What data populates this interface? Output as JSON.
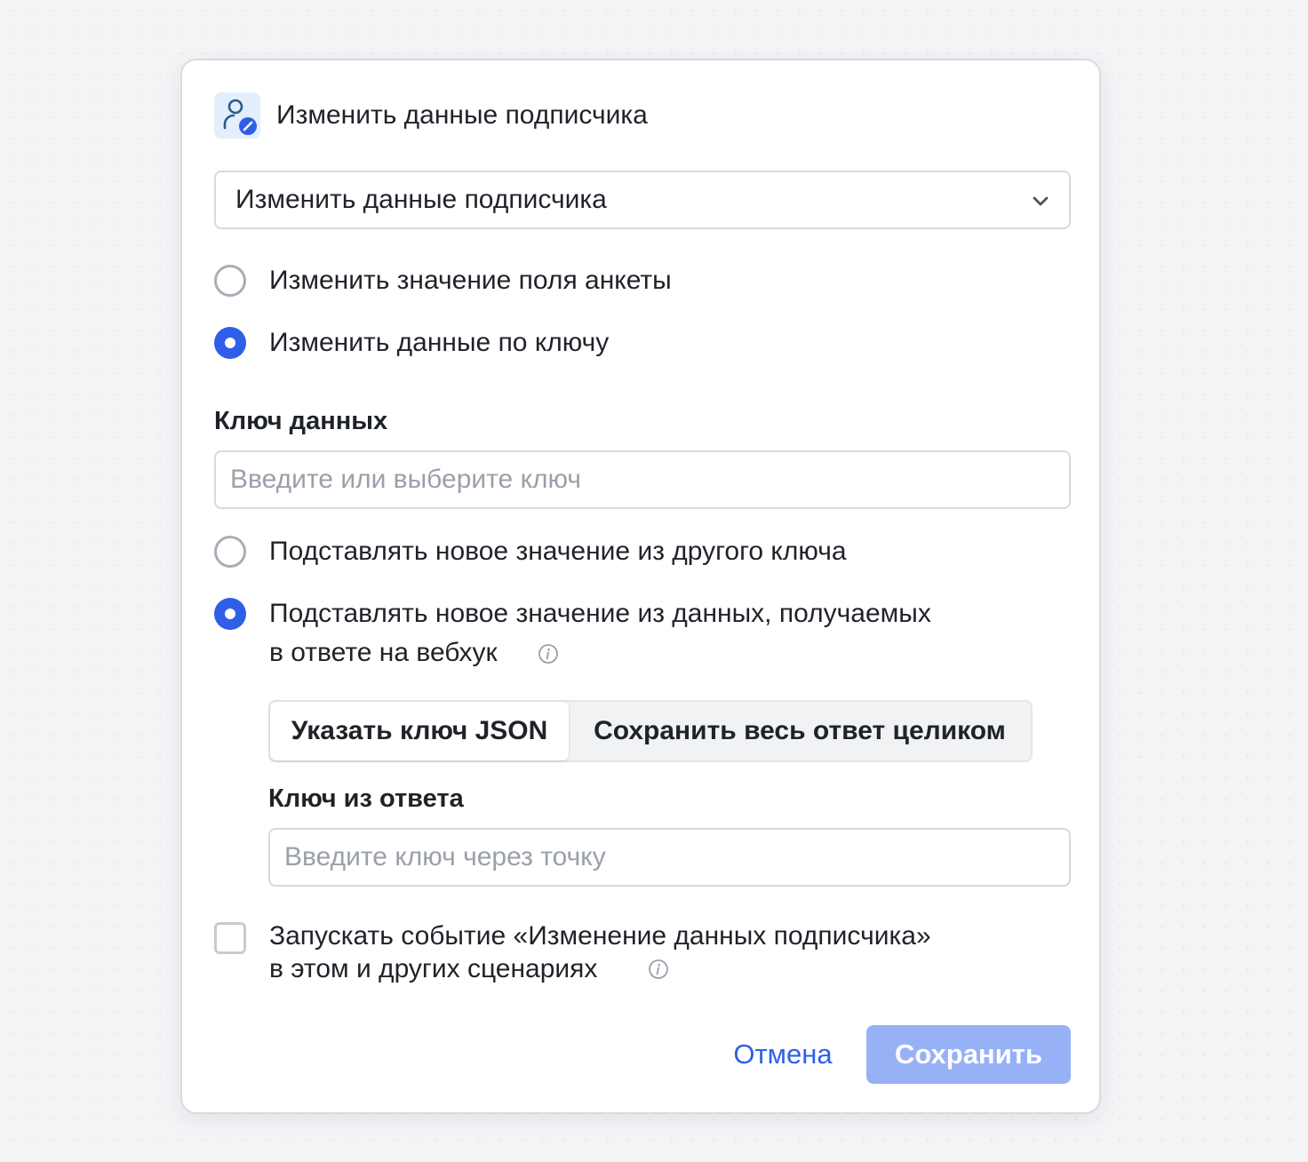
{
  "header": {
    "icon": "user-edit-icon",
    "title": "Изменить данные подписчика"
  },
  "action_select": {
    "value": "Изменить данные подписчика",
    "icon": "chevron-down-icon"
  },
  "mode_options": [
    {
      "label": "Изменить значение поля анкеты",
      "selected": false
    },
    {
      "label": "Изменить данные по ключу",
      "selected": true
    }
  ],
  "data_key": {
    "label": "Ключ данных",
    "placeholder": "Введите или выберите ключ",
    "value": ""
  },
  "source_options": [
    {
      "label": "Подставлять новое значение из другого ключа",
      "selected": false
    },
    {
      "label_line1": "Подставлять новое значение из данных, получаемых",
      "label_line2": "в ответе на вебхук",
      "selected": true,
      "info_icon": "info-icon"
    }
  ],
  "segmented": {
    "options": [
      "Указать ключ JSON",
      "Сохранить весь ответ целиком"
    ],
    "active_index": 0
  },
  "response_key": {
    "label": "Ключ из ответа",
    "placeholder": "Введите ключ через точку",
    "value": ""
  },
  "trigger_event": {
    "checked": false,
    "label_line1": "Запускать событие «Изменение данных подписчика»",
    "label_line2": "в этом и других сценариях",
    "info_icon": "info-icon"
  },
  "footer": {
    "cancel_label": "Отмена",
    "save_label": "Сохранить"
  },
  "colors": {
    "accent": "#2f5fe8",
    "save_disabled": "#97b1f7",
    "icon_bg": "#e3effc"
  }
}
